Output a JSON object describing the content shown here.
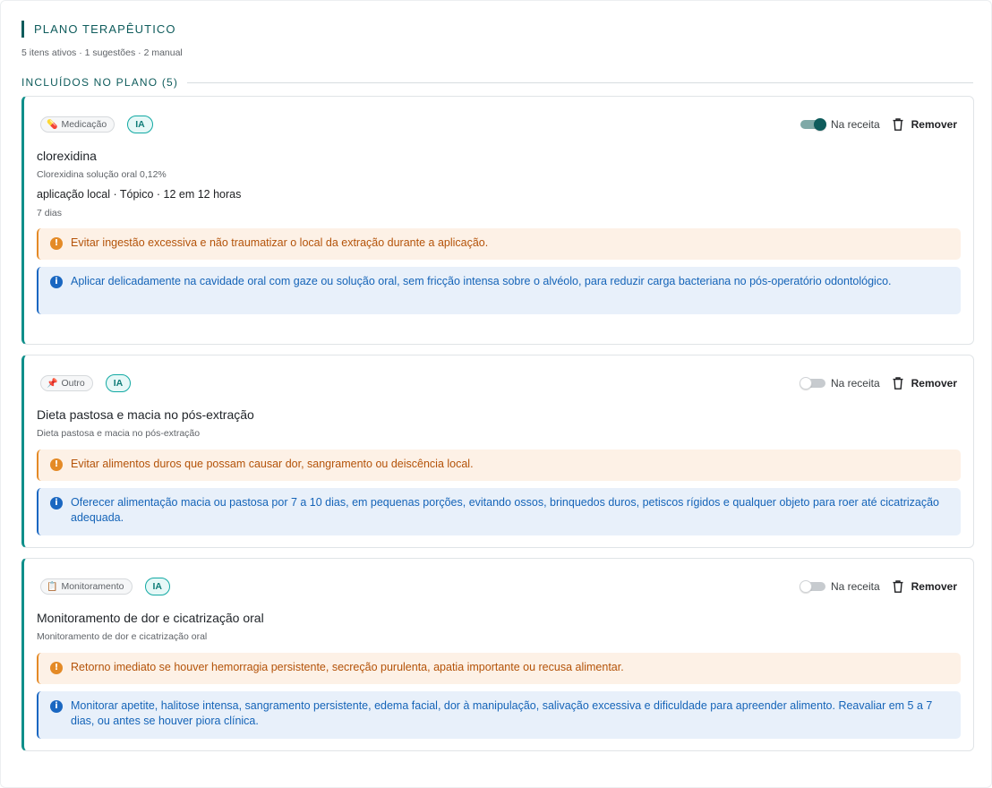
{
  "header": {
    "title": "PLANO TERAPÊUTICO",
    "subtitle": "5 itens ativos · 1 sugestões · 2 manual"
  },
  "section": {
    "title": "INCLUÍDOS NO PLANO (5)"
  },
  "labels": {
    "prescription_toggle": "Na receita",
    "remove": "Remover",
    "ai_badge": "IA"
  },
  "items": [
    {
      "category": "Medicação",
      "category_icon": "pill-icon",
      "in_prescription": true,
      "title": "clorexidina",
      "subtitle": "Clorexidina solução oral 0,12%",
      "dose": "aplicação local · Tópico · 12 em 12 horas",
      "duration": "7 dias",
      "warning": "Evitar ingestão excessiva e não traumatizar o local da extração durante a aplicação.",
      "info": "Aplicar delicadamente na cavidade oral com gaze ou solução oral, sem fricção intensa sobre o alvéolo, para reduzir carga bacteriana no pós-operatório odontológico."
    },
    {
      "category": "Outro",
      "category_icon": "pushpin-icon",
      "in_prescription": false,
      "title": "Dieta pastosa e macia no pós-extração",
      "subtitle": "Dieta pastosa e macia no pós-extração",
      "warning": "Evitar alimentos duros que possam causar dor, sangramento ou deiscência local.",
      "info": "Oferecer alimentação macia ou pastosa por 7 a 10 dias, em pequenas porções, evitando ossos, brinquedos duros, petiscos rígidos e qualquer objeto para roer até cicatrização adequada."
    },
    {
      "category": "Monitoramento",
      "category_icon": "clipboard-icon",
      "in_prescription": false,
      "title": "Monitoramento de dor e cicatrização oral",
      "subtitle": "Monitoramento de dor e cicatrização oral",
      "warning": "Retorno imediato se houver hemorragia persistente, secreção purulenta, apatia importante ou recusa alimentar.",
      "info": "Monitorar apetite, halitose intensa, sangramento persistente, edema facial, dor à manipulação, salivação excessiva e dificuldade para apreender alimento. Reavaliar em 5 a 7 dias, ou antes se houver piora clínica."
    }
  ]
}
